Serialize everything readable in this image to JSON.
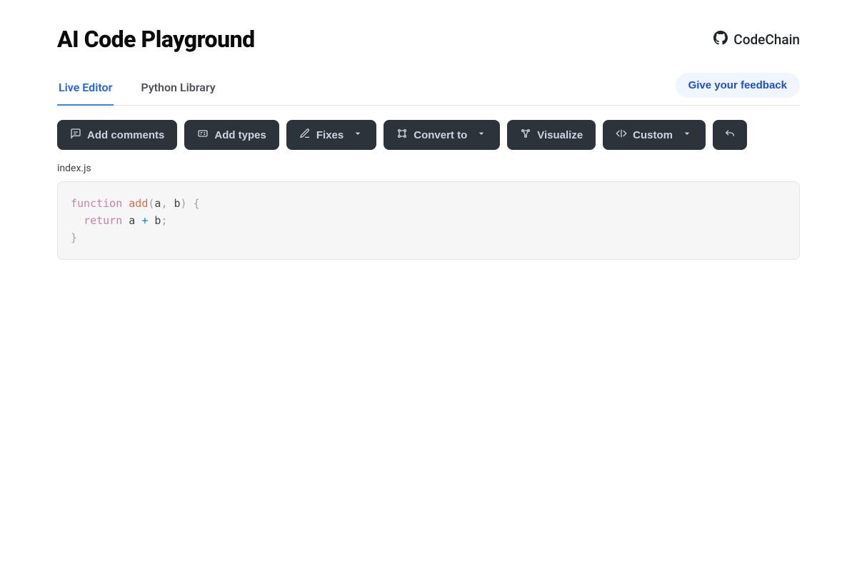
{
  "header": {
    "title": "AI Code Playground",
    "brand": "CodeChain"
  },
  "tabs": [
    {
      "label": "Live Editor",
      "active": true
    },
    {
      "label": "Python Library",
      "active": false
    }
  ],
  "feedback_label": "Give your feedback",
  "toolbar": {
    "add_comments": "Add comments",
    "add_types": "Add types",
    "fixes": "Fixes",
    "convert_to": "Convert to",
    "visualize": "Visualize",
    "custom": "Custom"
  },
  "editor": {
    "filename": "index.js",
    "code": {
      "line1_kw": "function",
      "line1_fn": "add",
      "line1_open": "(",
      "line1_a": "a",
      "line1_comma": ",",
      "line1_b": "b",
      "line1_close": ")",
      "line1_brace": "{",
      "line2_kw": "return",
      "line2_a": "a",
      "line2_op": "+",
      "line2_b": "b",
      "line2_semi": ";",
      "line3_brace": "}"
    }
  }
}
